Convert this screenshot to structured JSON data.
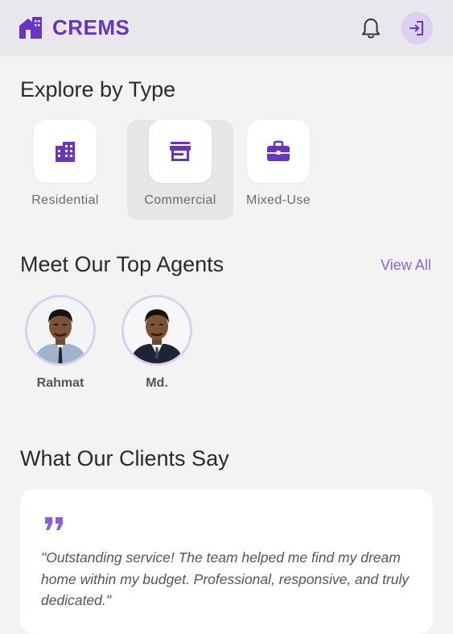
{
  "header": {
    "brand_name": "CREMS",
    "notification_icon": "bell-icon",
    "logout_icon": "login-arrow-icon",
    "accent_color": "#6a34c2"
  },
  "explore": {
    "title": "Explore by Type",
    "types": [
      {
        "label": "Residential",
        "icon": "building-icon",
        "selected": false
      },
      {
        "label": "Commercial",
        "icon": "storefront-icon",
        "selected": true
      },
      {
        "label": "Mixed-Use",
        "icon": "briefcase-icon",
        "selected": false
      }
    ]
  },
  "agents": {
    "title": "Meet Our Top Agents",
    "view_all_label": "View All",
    "list": [
      {
        "name": "Rahmat"
      },
      {
        "name": "Md."
      }
    ]
  },
  "testimonials": {
    "title": "What Our Clients Say",
    "quote_icon": "quote-icon",
    "quote": "\"Outstanding service! The team helped me find my dream home within my budget. Professional, responsive, and truly dedicated.\""
  }
}
